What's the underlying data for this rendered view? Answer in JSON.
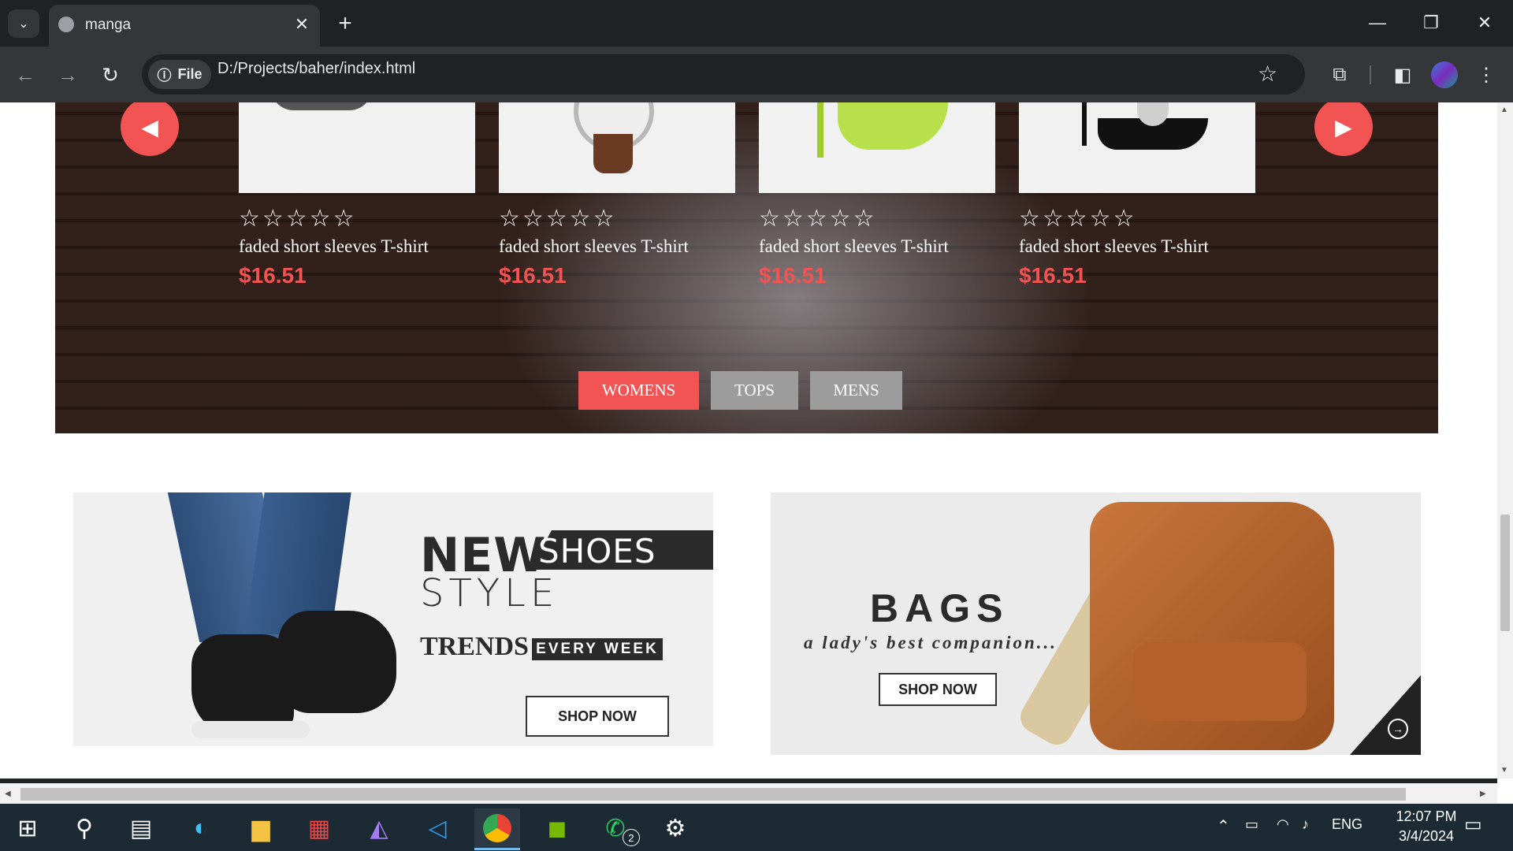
{
  "browser": {
    "tab_title": "manga",
    "site_info_label": "File",
    "url": "D:/Projects/baher/index.html"
  },
  "products": [
    {
      "stars": "☆☆☆☆☆",
      "name": "faded short sleeves T-shirt",
      "price": "$16.51"
    },
    {
      "stars": "☆☆☆☆☆",
      "name": "faded short sleeves T-shirt",
      "price": "$16.51"
    },
    {
      "stars": "☆☆☆☆☆",
      "name": "faded short sleeves T-shirt",
      "price": "$16.51"
    },
    {
      "stars": "☆☆☆☆☆",
      "name": "faded short sleeves T-shirt",
      "price": "$16.51"
    }
  ],
  "filters": [
    {
      "label": "WOMENS",
      "active": true
    },
    {
      "label": "TOPS",
      "active": false
    },
    {
      "label": "MENS",
      "active": false
    }
  ],
  "banners": {
    "shoes": {
      "new": "NEW",
      "shoes": "SHOES",
      "style": "STYLE",
      "trends": "TRENDS",
      "every_week": "EVERY WEEK",
      "button": "SHOP NOW"
    },
    "bags": {
      "title": "BAGS",
      "tagline": "a lady's best companion...",
      "button": "SHOP NOW"
    }
  },
  "taskbar": {
    "language": "ENG",
    "time": "12:07 PM",
    "date": "3/4/2024",
    "whatsapp_badge": "2"
  },
  "colors": {
    "accent": "#f25353",
    "chrome_dark": "#202124",
    "chrome_toolbar": "#35363a",
    "filter_inactive": "#9c9c9c"
  }
}
